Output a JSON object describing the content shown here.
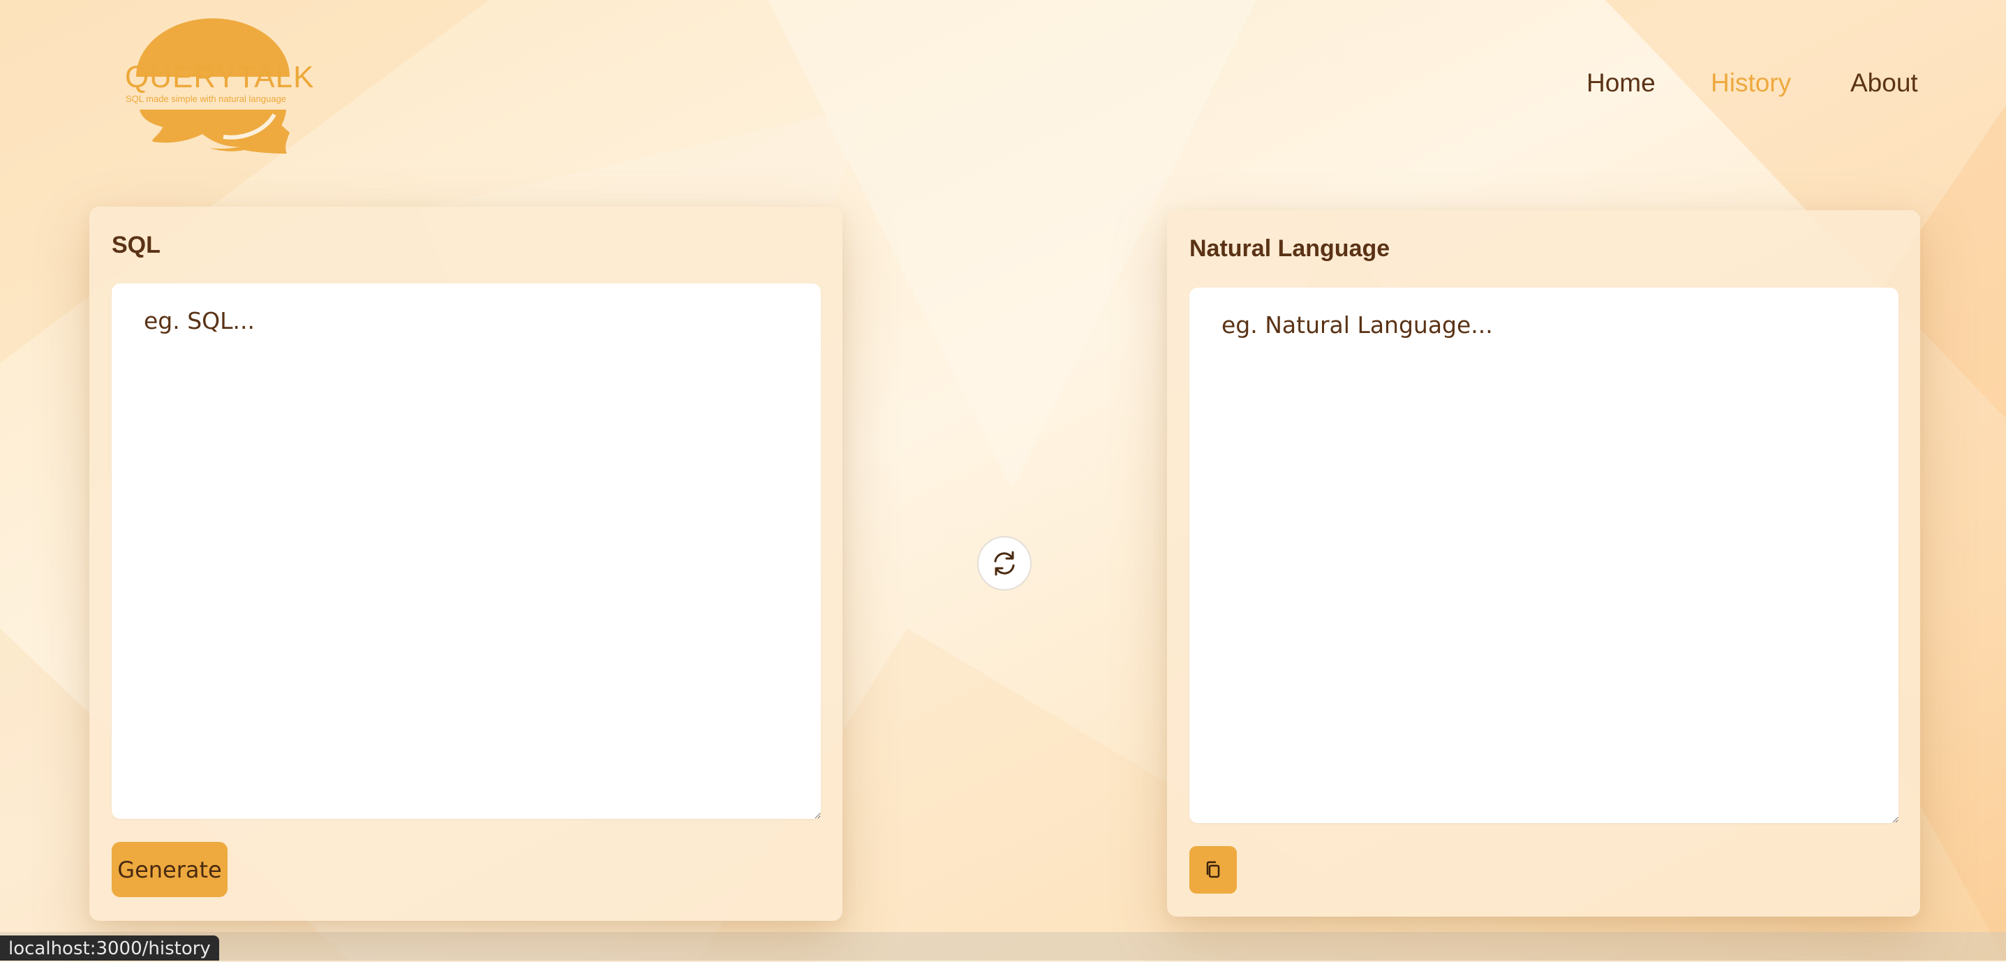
{
  "brand": {
    "name": "QUERYTALK",
    "tagline": "SQL made simple with natural language",
    "color": "#eda83a"
  },
  "nav": {
    "items": [
      {
        "label": "Home",
        "active": false
      },
      {
        "label": "History",
        "active": true
      },
      {
        "label": "About",
        "active": false
      }
    ]
  },
  "sql_panel": {
    "title": "SQL",
    "placeholder": "eg. SQL...",
    "value": "",
    "generate_label": "Generate"
  },
  "nl_panel": {
    "title": "Natural Language",
    "placeholder": "eg. Natural Language...",
    "value": ""
  },
  "icons": {
    "swap": "swap-arrows-icon",
    "copy": "copy-icon"
  },
  "status_bar": {
    "url": "localhost:3000/history"
  },
  "colors": {
    "accent": "#eeaa3f",
    "text": "#5a3215",
    "background": "#fdf1dc"
  }
}
